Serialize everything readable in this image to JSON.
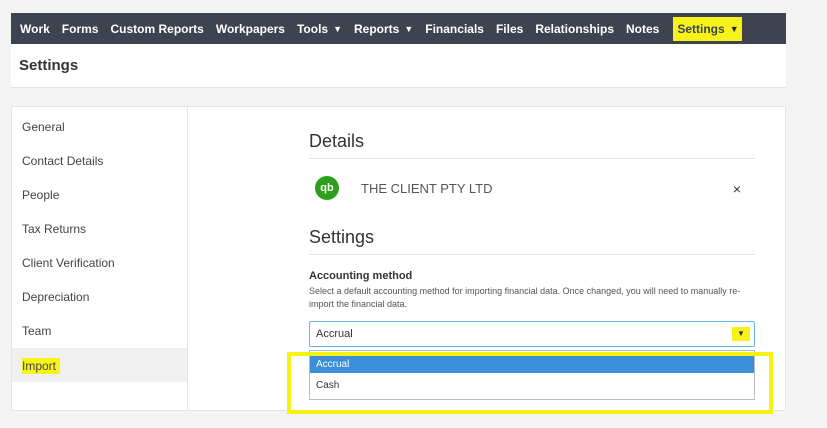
{
  "nav": {
    "items": [
      {
        "label": "Work",
        "caret": false
      },
      {
        "label": "Forms",
        "caret": false
      },
      {
        "label": "Custom Reports",
        "caret": false
      },
      {
        "label": "Workpapers",
        "caret": false
      },
      {
        "label": "Tools",
        "caret": true
      },
      {
        "label": "Reports",
        "caret": true
      },
      {
        "label": "Financials",
        "caret": false
      },
      {
        "label": "Files",
        "caret": false
      },
      {
        "label": "Relationships",
        "caret": false
      },
      {
        "label": "Notes",
        "caret": false
      }
    ],
    "settings_label": "Settings"
  },
  "page": {
    "title": "Settings"
  },
  "sidebar": {
    "items": [
      {
        "label": "General"
      },
      {
        "label": "Contact Details"
      },
      {
        "label": "People"
      },
      {
        "label": "Tax Returns"
      },
      {
        "label": "Client Verification"
      },
      {
        "label": "Depreciation"
      },
      {
        "label": "Team"
      },
      {
        "label": "Import"
      }
    ],
    "active": "Import"
  },
  "details": {
    "title": "Details",
    "client_icon": "qb",
    "client_name": "THE CLIENT PTY LTD",
    "close": "×"
  },
  "settings_section": {
    "title": "Settings",
    "field_label": "Accounting method",
    "help_text": "Select a default accounting method for importing financial data. Once changed, you will need to manually re-import the financial data.",
    "selected_value": "Accrual",
    "options": [
      "Accrual",
      "Cash"
    ]
  },
  "colors": {
    "nav_bg": "#3d4450",
    "highlight": "#f7f31a",
    "option_selected": "#3a8fd6",
    "qb_green": "#2ca01c"
  }
}
